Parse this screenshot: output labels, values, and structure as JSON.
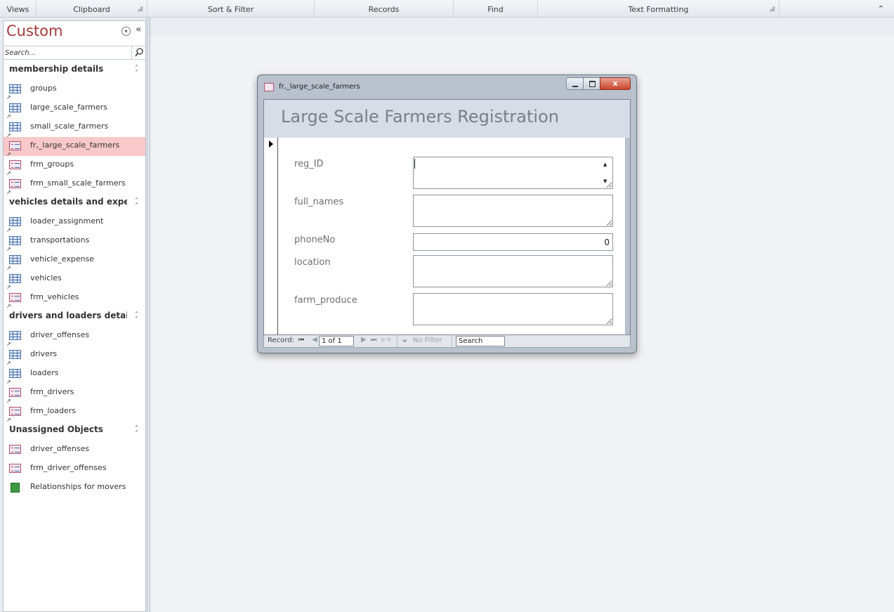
{
  "ribbon": {
    "groups": [
      {
        "label": "Views"
      },
      {
        "label": "Clipboard"
      },
      {
        "label": "Sort & Filter"
      },
      {
        "label": "Records"
      },
      {
        "label": "Find"
      },
      {
        "label": "Text Formatting"
      }
    ],
    "collapse_icon": "chevron-up-icon"
  },
  "nav": {
    "title": "Custom",
    "search_placeholder": "Search...",
    "groups": [
      {
        "label": "membership details",
        "items": [
          {
            "label": "groups",
            "icon": "table-icon"
          },
          {
            "label": "large_scale_farmers",
            "icon": "table-icon"
          },
          {
            "label": "small_scale_farmers",
            "icon": "table-icon"
          },
          {
            "label": "fr,_large_scale_farmers",
            "icon": "form-icon",
            "selected": true
          },
          {
            "label": "frm_groups",
            "icon": "form-icon"
          },
          {
            "label": "frm_small_scale_farmers",
            "icon": "form-icon"
          }
        ]
      },
      {
        "label": "vehicles details and expe...",
        "items": [
          {
            "label": "loader_assignment",
            "icon": "table-icon"
          },
          {
            "label": "transportations",
            "icon": "table-icon"
          },
          {
            "label": "vehicle_expense",
            "icon": "table-icon"
          },
          {
            "label": "vehicles",
            "icon": "table-icon"
          },
          {
            "label": "frm_vehicles",
            "icon": "form-icon"
          }
        ]
      },
      {
        "label": "drivers and loaders details",
        "items": [
          {
            "label": "driver_offenses",
            "icon": "table-icon"
          },
          {
            "label": "drivers",
            "icon": "table-icon"
          },
          {
            "label": "loaders",
            "icon": "table-icon"
          },
          {
            "label": "frm_drivers",
            "icon": "form-icon"
          },
          {
            "label": "frm_loaders",
            "icon": "form-icon"
          }
        ]
      },
      {
        "label": "Unassigned Objects",
        "items": [
          {
            "label": "driver_offenses",
            "icon": "form-icon"
          },
          {
            "label": "frm_driver_offenses",
            "icon": "form-icon"
          },
          {
            "label": "Relationships for movers",
            "icon": "relationship-icon"
          }
        ]
      }
    ]
  },
  "form_window": {
    "title": "fr,_large_scale_farmers",
    "close_glyph": "x",
    "heading": "Large Scale Farmers Registration",
    "fields": {
      "reg_id_label": "reg_ID",
      "reg_id_value": "",
      "full_names_label": "full_names",
      "full_names_value": "",
      "phone_label": "phoneNo",
      "phone_value": "0",
      "location_label": "location",
      "location_value": "",
      "farm_produce_label": "farm_produce",
      "farm_produce_value": ""
    },
    "record_nav": {
      "label": "Record:",
      "current": "1 of 1",
      "filter_label": "No Filter",
      "search_placeholder": "Search"
    }
  }
}
